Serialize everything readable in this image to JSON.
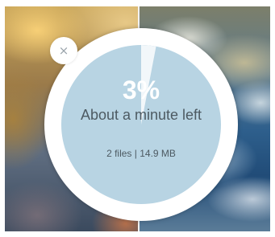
{
  "transfer": {
    "close_icon": "×",
    "progress_fraction": 0.03,
    "percent_text": "3%",
    "time_left_text": "About a minute left",
    "files_text": "2 files",
    "separator": "|",
    "size_text": "14.9 MB"
  },
  "colors": {
    "progress_disc": "#b8d4e3",
    "progress_fill": "#f2f7fa",
    "ring": "#ffffff",
    "text_dark": "#4d5a62",
    "close_icon": "#9aa4ab"
  },
  "icons": {
    "close": "close-icon"
  }
}
